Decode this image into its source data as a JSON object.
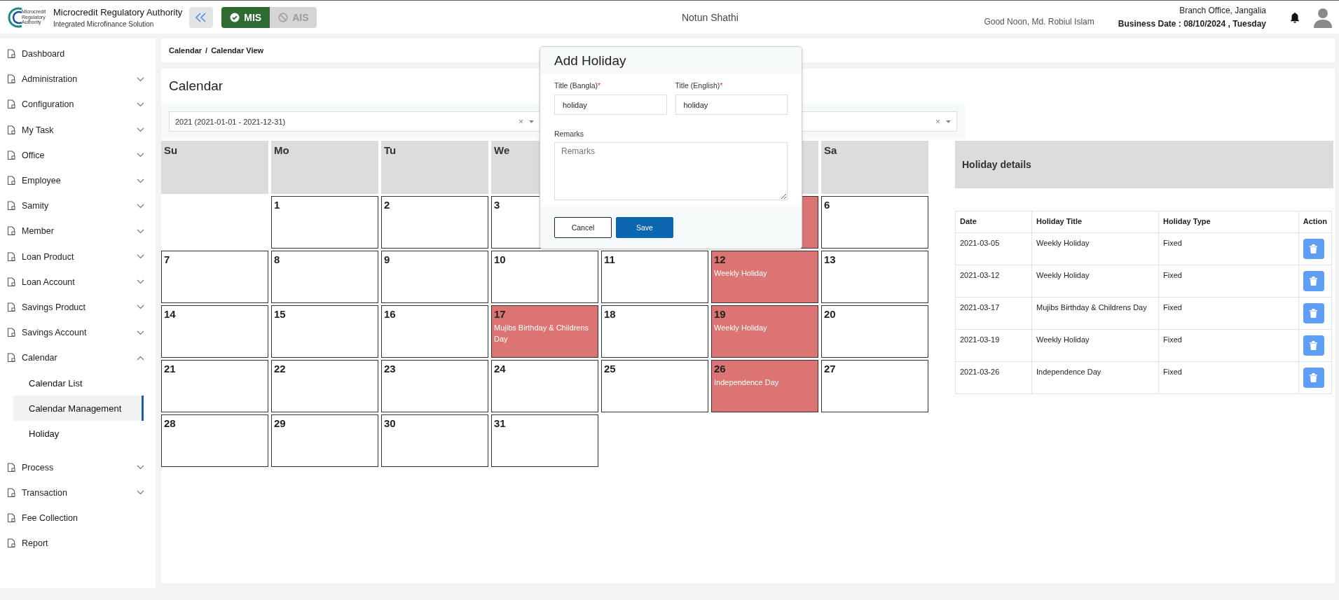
{
  "header": {
    "org_name": "Microcredit Regulatory Authority",
    "org_subtitle": "Integrated Microfinance Solution",
    "logo_text": "Microcredit Regulatory Authority",
    "modules": [
      {
        "label": "MIS",
        "selected": true
      },
      {
        "label": "AIS",
        "selected": false
      }
    ],
    "app_name": "Notun Shathi",
    "greeting": "Good Noon, Md. Robiul Islam",
    "branch": "Branch Office, Jangalia",
    "business_date": "Business Date : 08/10/2024 , Tuesday"
  },
  "sidebar": {
    "items": [
      {
        "label": "Dashboard",
        "kind": "link"
      },
      {
        "label": "Administration",
        "kind": "group",
        "expanded": false
      },
      {
        "label": "Configuration",
        "kind": "group",
        "expanded": false
      },
      {
        "label": "My Task",
        "kind": "group",
        "expanded": false
      },
      {
        "label": "Office",
        "kind": "group",
        "expanded": false
      },
      {
        "label": "Employee",
        "kind": "group",
        "expanded": false
      },
      {
        "label": "Samity",
        "kind": "group",
        "expanded": false
      },
      {
        "label": "Member",
        "kind": "group",
        "expanded": false
      },
      {
        "label": "Loan Product",
        "kind": "group",
        "expanded": false
      },
      {
        "label": "Loan Account",
        "kind": "group",
        "expanded": false
      },
      {
        "label": "Savings Product",
        "kind": "group",
        "expanded": false
      },
      {
        "label": "Savings Account",
        "kind": "group",
        "expanded": false
      },
      {
        "label": "Calendar",
        "kind": "group",
        "expanded": true,
        "children": [
          {
            "label": "Calendar List",
            "selected": false
          },
          {
            "label": "Calendar Management",
            "selected": true
          },
          {
            "label": "Holiday",
            "selected": false
          }
        ]
      },
      {
        "label": "Process",
        "kind": "group",
        "expanded": false
      },
      {
        "label": "Transaction",
        "kind": "group",
        "expanded": false
      },
      {
        "label": "Fee Collection",
        "kind": "link"
      },
      {
        "label": "Report",
        "kind": "link"
      }
    ]
  },
  "breadcrumb": {
    "items": [
      "Calendar",
      "Calendar View"
    ],
    "separator": "/"
  },
  "calendar": {
    "title": "Calendar",
    "filters": [
      {
        "value": "2021 (2021-01-01 - 2021-12-31)",
        "clear": "×"
      },
      {
        "clear": "×"
      }
    ],
    "weekdays": [
      "Su",
      "Mo",
      "Tu",
      "We",
      "Sa"
    ],
    "weeks": [
      [
        {
          "day": "1",
          "holiday": false
        },
        {
          "day": "2",
          "holiday": false
        },
        {
          "day": "3",
          "holiday": false
        },
        {
          "holiday": true
        },
        {
          "day": "6",
          "holiday": false
        }
      ],
      [
        {
          "day": "7",
          "holiday": false
        },
        {
          "day": "8",
          "holiday": false
        },
        {
          "day": "9",
          "holiday": false
        },
        {
          "day": "10",
          "holiday": false
        },
        {
          "day": "11",
          "holiday": false
        },
        {
          "day": "12",
          "holiday": true,
          "title": "Weekly Holiday"
        },
        {
          "day": "13",
          "holiday": false
        }
      ],
      [
        {
          "day": "14",
          "holiday": false
        },
        {
          "day": "15",
          "holiday": false
        },
        {
          "day": "16",
          "holiday": false
        },
        {
          "day": "17",
          "holiday": true,
          "title": "Mujibs Birthday & Childrens Day"
        },
        {
          "day": "18",
          "holiday": false
        },
        {
          "day": "19",
          "holiday": true,
          "title": "Weekly Holiday"
        },
        {
          "day": "20",
          "holiday": false
        }
      ],
      [
        {
          "day": "21",
          "holiday": false
        },
        {
          "day": "22",
          "holiday": false
        },
        {
          "day": "23",
          "holiday": false
        },
        {
          "day": "24",
          "holiday": false
        },
        {
          "day": "25",
          "holiday": false
        },
        {
          "day": "26",
          "holiday": true,
          "title": "Independence Day"
        },
        {
          "day": "27",
          "holiday": false
        }
      ],
      [
        {
          "day": "28",
          "holiday": false
        },
        {
          "day": "29",
          "holiday": false
        },
        {
          "day": "30",
          "holiday": false
        },
        {
          "day": "31",
          "holiday": false
        }
      ]
    ]
  },
  "holiday_details": {
    "title": "Holiday details",
    "columns": [
      "Date",
      "Holiday Title",
      "Holiday Type",
      "Action"
    ],
    "rows": [
      {
        "date": "2021-03-05",
        "title": "Weekly Holiday",
        "type": "Fixed"
      },
      {
        "date": "2021-03-12",
        "title": "Weekly Holiday",
        "type": "Fixed"
      },
      {
        "date": "2021-03-17",
        "title": "Mujibs Birthday & Childrens Day",
        "type": "Fixed"
      },
      {
        "date": "2021-03-19",
        "title": "Weekly Holiday",
        "type": "Fixed"
      },
      {
        "date": "2021-03-26",
        "title": "Independence Day",
        "type": "Fixed"
      }
    ]
  },
  "modal": {
    "title": "Add Holiday",
    "fields": [
      {
        "label": "Title (Bangla)",
        "required_mark": "*",
        "value": "holiday"
      },
      {
        "label": "Title (English)",
        "required_mark": "*",
        "value": "holiday"
      }
    ],
    "remarks": {
      "label": "Remarks",
      "placeholder": "Remarks"
    },
    "buttons": [
      {
        "label": "Cancel",
        "kind": "secondary"
      },
      {
        "label": "Save",
        "kind": "primary"
      }
    ]
  }
}
